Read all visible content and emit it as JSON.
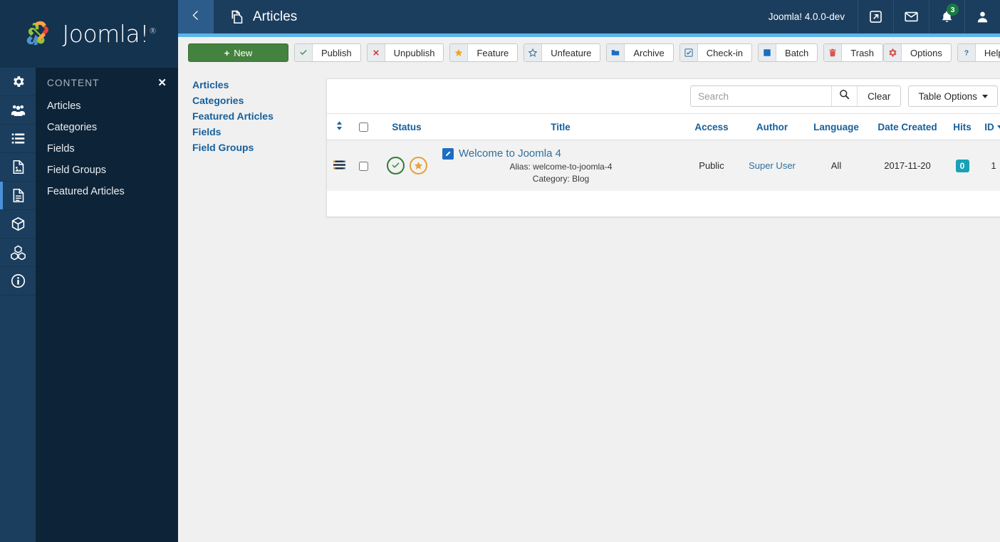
{
  "brand": {
    "name": "Joomla!",
    "trademark": "®",
    "logo_icon": "joomla-logo-icon"
  },
  "sidebar": {
    "rail_items": [
      {
        "name": "system",
        "icon": "gear-icon"
      },
      {
        "name": "users",
        "icon": "users-icon"
      },
      {
        "name": "menus",
        "icon": "list-icon"
      },
      {
        "name": "media",
        "icon": "image-file-icon"
      },
      {
        "name": "content",
        "icon": "document-icon",
        "active": true
      },
      {
        "name": "components",
        "icon": "cube-icon"
      },
      {
        "name": "extensions-modules",
        "icon": "blocks-icon"
      },
      {
        "name": "help",
        "icon": "info-circle-icon"
      }
    ],
    "menu": {
      "title": "CONTENT",
      "close_icon": "close-icon",
      "items": [
        {
          "label": "Articles"
        },
        {
          "label": "Categories"
        },
        {
          "label": "Fields"
        },
        {
          "label": "Field Groups"
        },
        {
          "label": "Featured Articles"
        }
      ]
    }
  },
  "header": {
    "back_icon": "chevron-left-icon",
    "title": "Articles",
    "title_icon": "articles-icon",
    "version": "Joomla! 4.0.0-dev",
    "actions": [
      {
        "name": "preview-site",
        "icon": "external-link-icon",
        "badge": null
      },
      {
        "name": "messages",
        "icon": "envelope-icon",
        "badge": null
      },
      {
        "name": "notifications",
        "icon": "bell-icon",
        "badge": "3"
      },
      {
        "name": "user-account",
        "icon": "user-icon",
        "badge": null
      }
    ]
  },
  "toolbar": {
    "new_label": "New",
    "new_plus": "+",
    "buttons": [
      {
        "label": "Publish",
        "icon": "check-icon",
        "icon_color": "#4c9a4f"
      },
      {
        "label": "Unpublish",
        "icon": "x-icon",
        "icon_color": "#c9302c"
      },
      {
        "label": "Feature",
        "icon": "star-icon",
        "icon_color": "#f0a32e"
      },
      {
        "label": "Unfeature",
        "icon": "star-outline-icon",
        "icon_color": "#2e6f9e"
      },
      {
        "label": "Archive",
        "icon": "folder-icon",
        "icon_color": "#1b6ec2"
      },
      {
        "label": "Check-in",
        "icon": "checkbox-icon",
        "icon_color": "#2e6f9e"
      },
      {
        "label": "Batch",
        "icon": "square-icon",
        "icon_color": "#1b6ec2"
      },
      {
        "label": "Trash",
        "icon": "trash-icon",
        "icon_color": "#d9534f"
      }
    ],
    "right_buttons": [
      {
        "label": "Options",
        "icon": "gear-icon",
        "icon_color": "#d9534f"
      },
      {
        "label": "Help",
        "icon": "question-icon",
        "icon_color": "#2e6f9e"
      }
    ]
  },
  "subnav": {
    "items": [
      {
        "label": "Articles"
      },
      {
        "label": "Categories"
      },
      {
        "label": "Featured Articles"
      },
      {
        "label": "Fields"
      },
      {
        "label": "Field Groups"
      }
    ]
  },
  "search": {
    "value": "",
    "placeholder": "Search",
    "search_icon": "search-icon",
    "clear_label": "Clear",
    "table_options_label": "Table Options"
  },
  "table": {
    "columns": [
      {
        "key": "ordering",
        "label": "",
        "sortable": true
      },
      {
        "key": "select",
        "label": "",
        "sortable": false
      },
      {
        "key": "status",
        "label": "Status",
        "sortable": true
      },
      {
        "key": "title",
        "label": "Title",
        "sortable": true
      },
      {
        "key": "access",
        "label": "Access",
        "sortable": true
      },
      {
        "key": "author",
        "label": "Author",
        "sortable": true
      },
      {
        "key": "language",
        "label": "Language",
        "sortable": true
      },
      {
        "key": "date",
        "label": "Date Created",
        "sortable": true
      },
      {
        "key": "hits",
        "label": "Hits",
        "sortable": true
      },
      {
        "key": "id",
        "label": "ID",
        "sortable": true,
        "sorted": "desc"
      }
    ],
    "rows": [
      {
        "status": {
          "published": true,
          "featured": true
        },
        "title": "Welcome to Joomla 4",
        "alias_label": "Alias:",
        "alias": "welcome-to-joomla-4",
        "category_label": "Category:",
        "category": "Blog",
        "access": "Public",
        "author": "Super User",
        "language": "All",
        "date_created": "2017-11-20",
        "hits": "0",
        "id": "1"
      }
    ]
  },
  "colors": {
    "brand_dark": "#14334f",
    "rail": "#1b3e5e",
    "menu_panel": "#0d2438",
    "header": "#1b3e5e",
    "header_accent": "#5cb5e8",
    "link_blue": "#16609c",
    "new_green": "#44823f",
    "hits_badge": "#18a2b8",
    "notif_green": "#1a7a42"
  }
}
